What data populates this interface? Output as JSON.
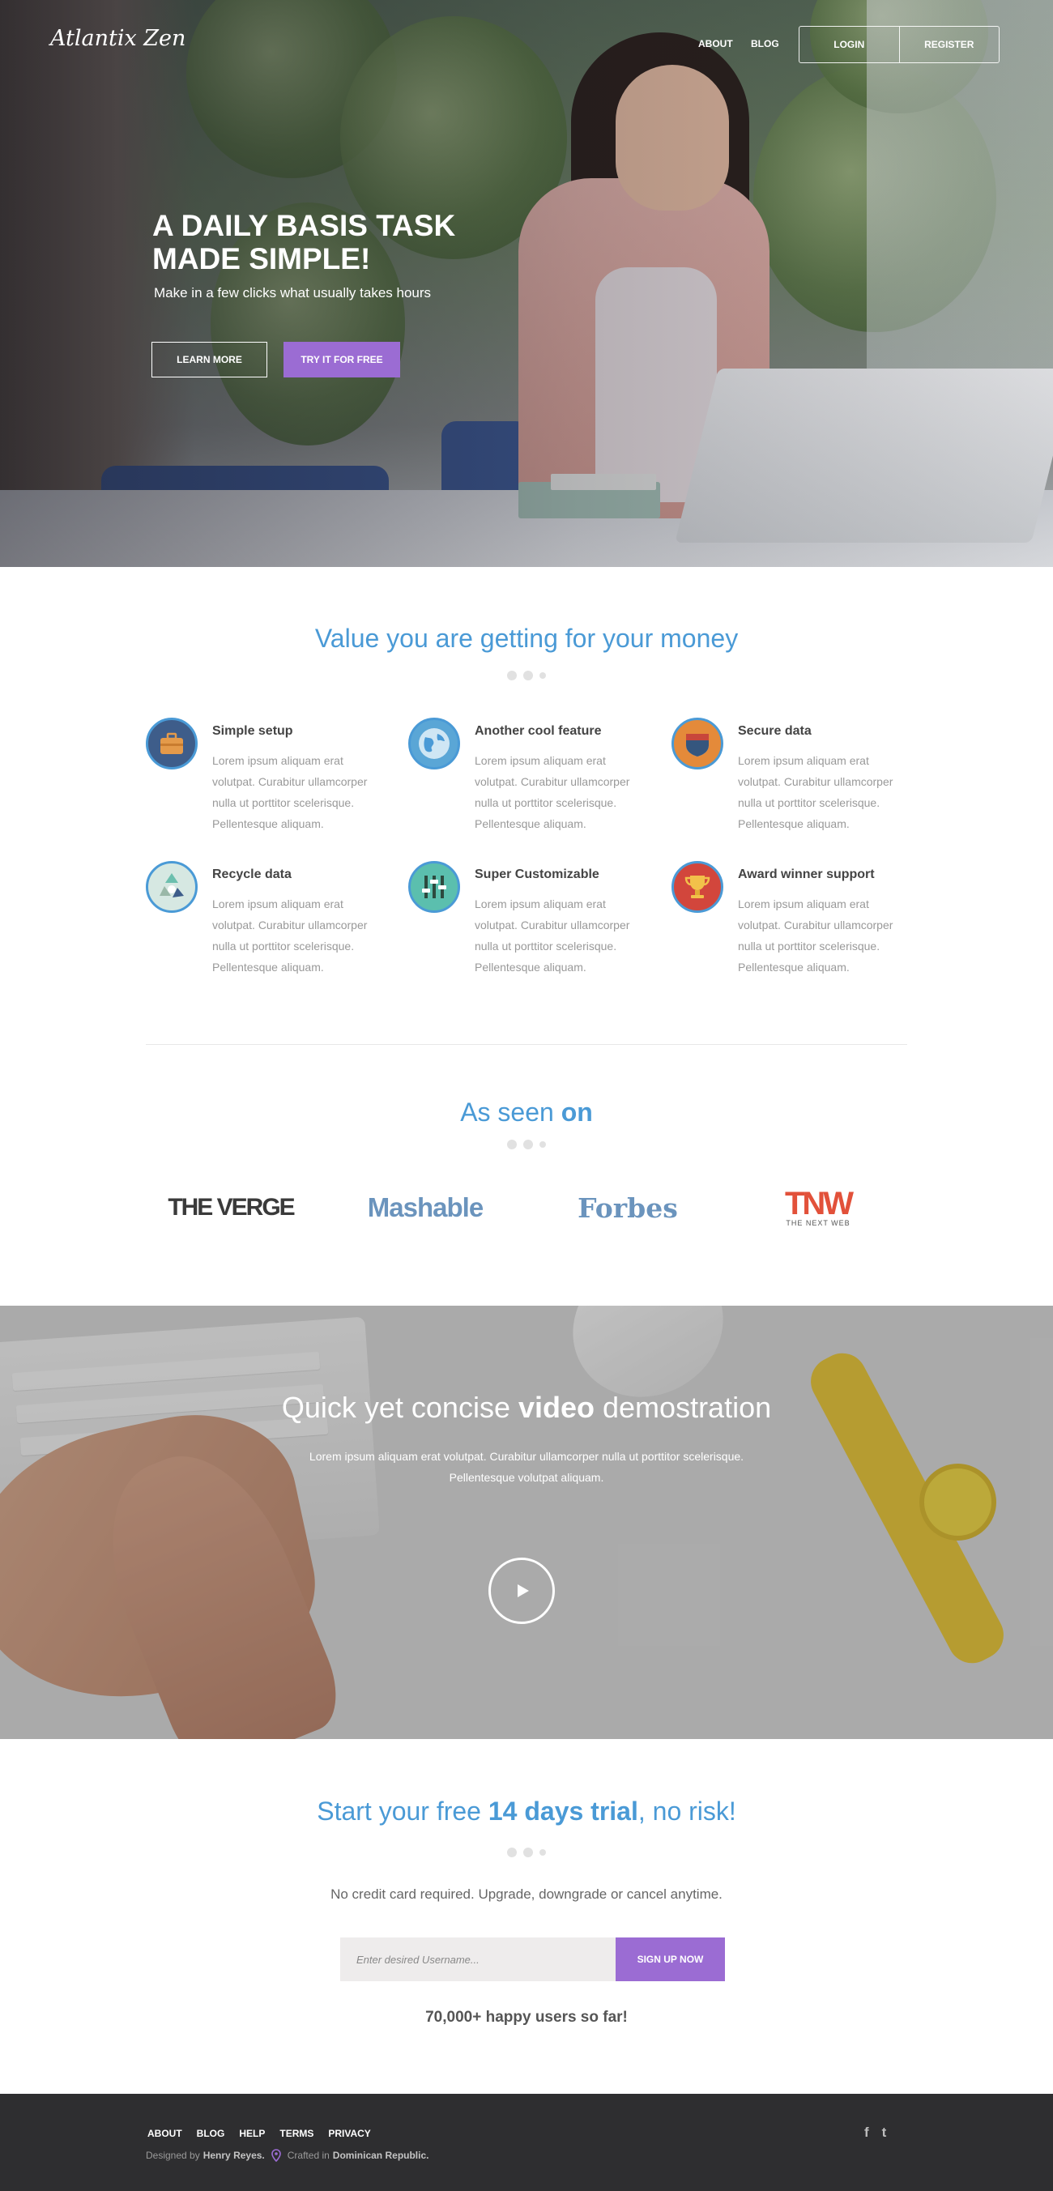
{
  "header": {
    "logo": "Atlantix Zen",
    "nav": [
      {
        "label": "ABOUT"
      },
      {
        "label": "BLOG"
      }
    ],
    "login_label": "LOGIN",
    "register_label": "REGISTER"
  },
  "hero": {
    "title": "A DAILY BASIS TASK MADE SIMPLE!",
    "subtitle": "Make in a few clicks what usually takes hours",
    "learn_more_label": "LEARN MORE",
    "try_label": "TRY IT FOR FREE"
  },
  "value_section": {
    "title": "Value you are getting for your money",
    "features": [
      {
        "title": "Simple setup",
        "text": "Lorem ipsum aliquam erat volutpat. Curabitur ullamcorper nulla ut porttitor scelerisque. Pellentesque aliquam.",
        "icon": "briefcase-icon"
      },
      {
        "title": "Another cool feature",
        "text": "Lorem ipsum aliquam erat volutpat. Curabitur ullamcorper nulla ut porttitor scelerisque. Pellentesque aliquam.",
        "icon": "globe-icon"
      },
      {
        "title": "Secure data",
        "text": "Lorem ipsum aliquam erat volutpat. Curabitur ullamcorper nulla ut porttitor scelerisque. Pellentesque aliquam.",
        "icon": "shield-icon"
      },
      {
        "title": "Recycle data",
        "text": "Lorem ipsum aliquam erat volutpat. Curabitur ullamcorper nulla ut porttitor scelerisque. Pellentesque aliquam.",
        "icon": "recycle-icon"
      },
      {
        "title": "Super Customizable",
        "text": "Lorem ipsum aliquam erat volutpat. Curabitur ullamcorper nulla ut porttitor scelerisque. Pellentesque aliquam.",
        "icon": "sliders-icon"
      },
      {
        "title": "Award winner support",
        "text": "Lorem ipsum aliquam erat volutpat. Curabitur ullamcorper nulla ut porttitor scelerisque. Pellentesque aliquam.",
        "icon": "trophy-icon"
      }
    ]
  },
  "seen_on": {
    "title_prefix": "As seen ",
    "title_bold": "on",
    "brands": [
      {
        "name": "THE VERGE"
      },
      {
        "name": "Mashable"
      },
      {
        "name": "Forbes"
      },
      {
        "name": "TNW",
        "tagline": "THE NEXT WEB"
      }
    ]
  },
  "video": {
    "title_prefix": "Quick yet concise ",
    "title_bold": "video",
    "title_suffix": " demostration",
    "text": "Lorem ipsum aliquam erat volutpat. Curabitur ullamcorper nulla ut porttitor scelerisque. Pellentesque volutpat aliquam.",
    "play_icon": "play-icon"
  },
  "trial": {
    "title_prefix": "Start your free ",
    "title_bold": "14 days trial",
    "title_suffix": ", no risk!",
    "note": "No credit card required. Upgrade, downgrade or cancel anytime.",
    "username_placeholder": "Enter desired Username...",
    "signup_label": "SIGN UP NOW",
    "happy_users": "70,000+ happy users so far!"
  },
  "footer": {
    "links": [
      {
        "label": "ABOUT"
      },
      {
        "label": "BLOG"
      },
      {
        "label": "HELP"
      },
      {
        "label": "TERMS"
      },
      {
        "label": "PRIVACY"
      }
    ],
    "designed_by_prefix": "Designed by",
    "designer": "Henry Reyes.",
    "crafted_prefix": "Crafted in",
    "crafted_place": "Dominican Republic.",
    "social": [
      {
        "icon": "facebook-icon",
        "glyph": "f"
      },
      {
        "icon": "twitter-icon",
        "glyph": "t"
      }
    ]
  },
  "colors": {
    "accent_blue": "#4a9ad6",
    "accent_purple": "#9b6cd3",
    "footer_bg": "#2e2e30"
  }
}
